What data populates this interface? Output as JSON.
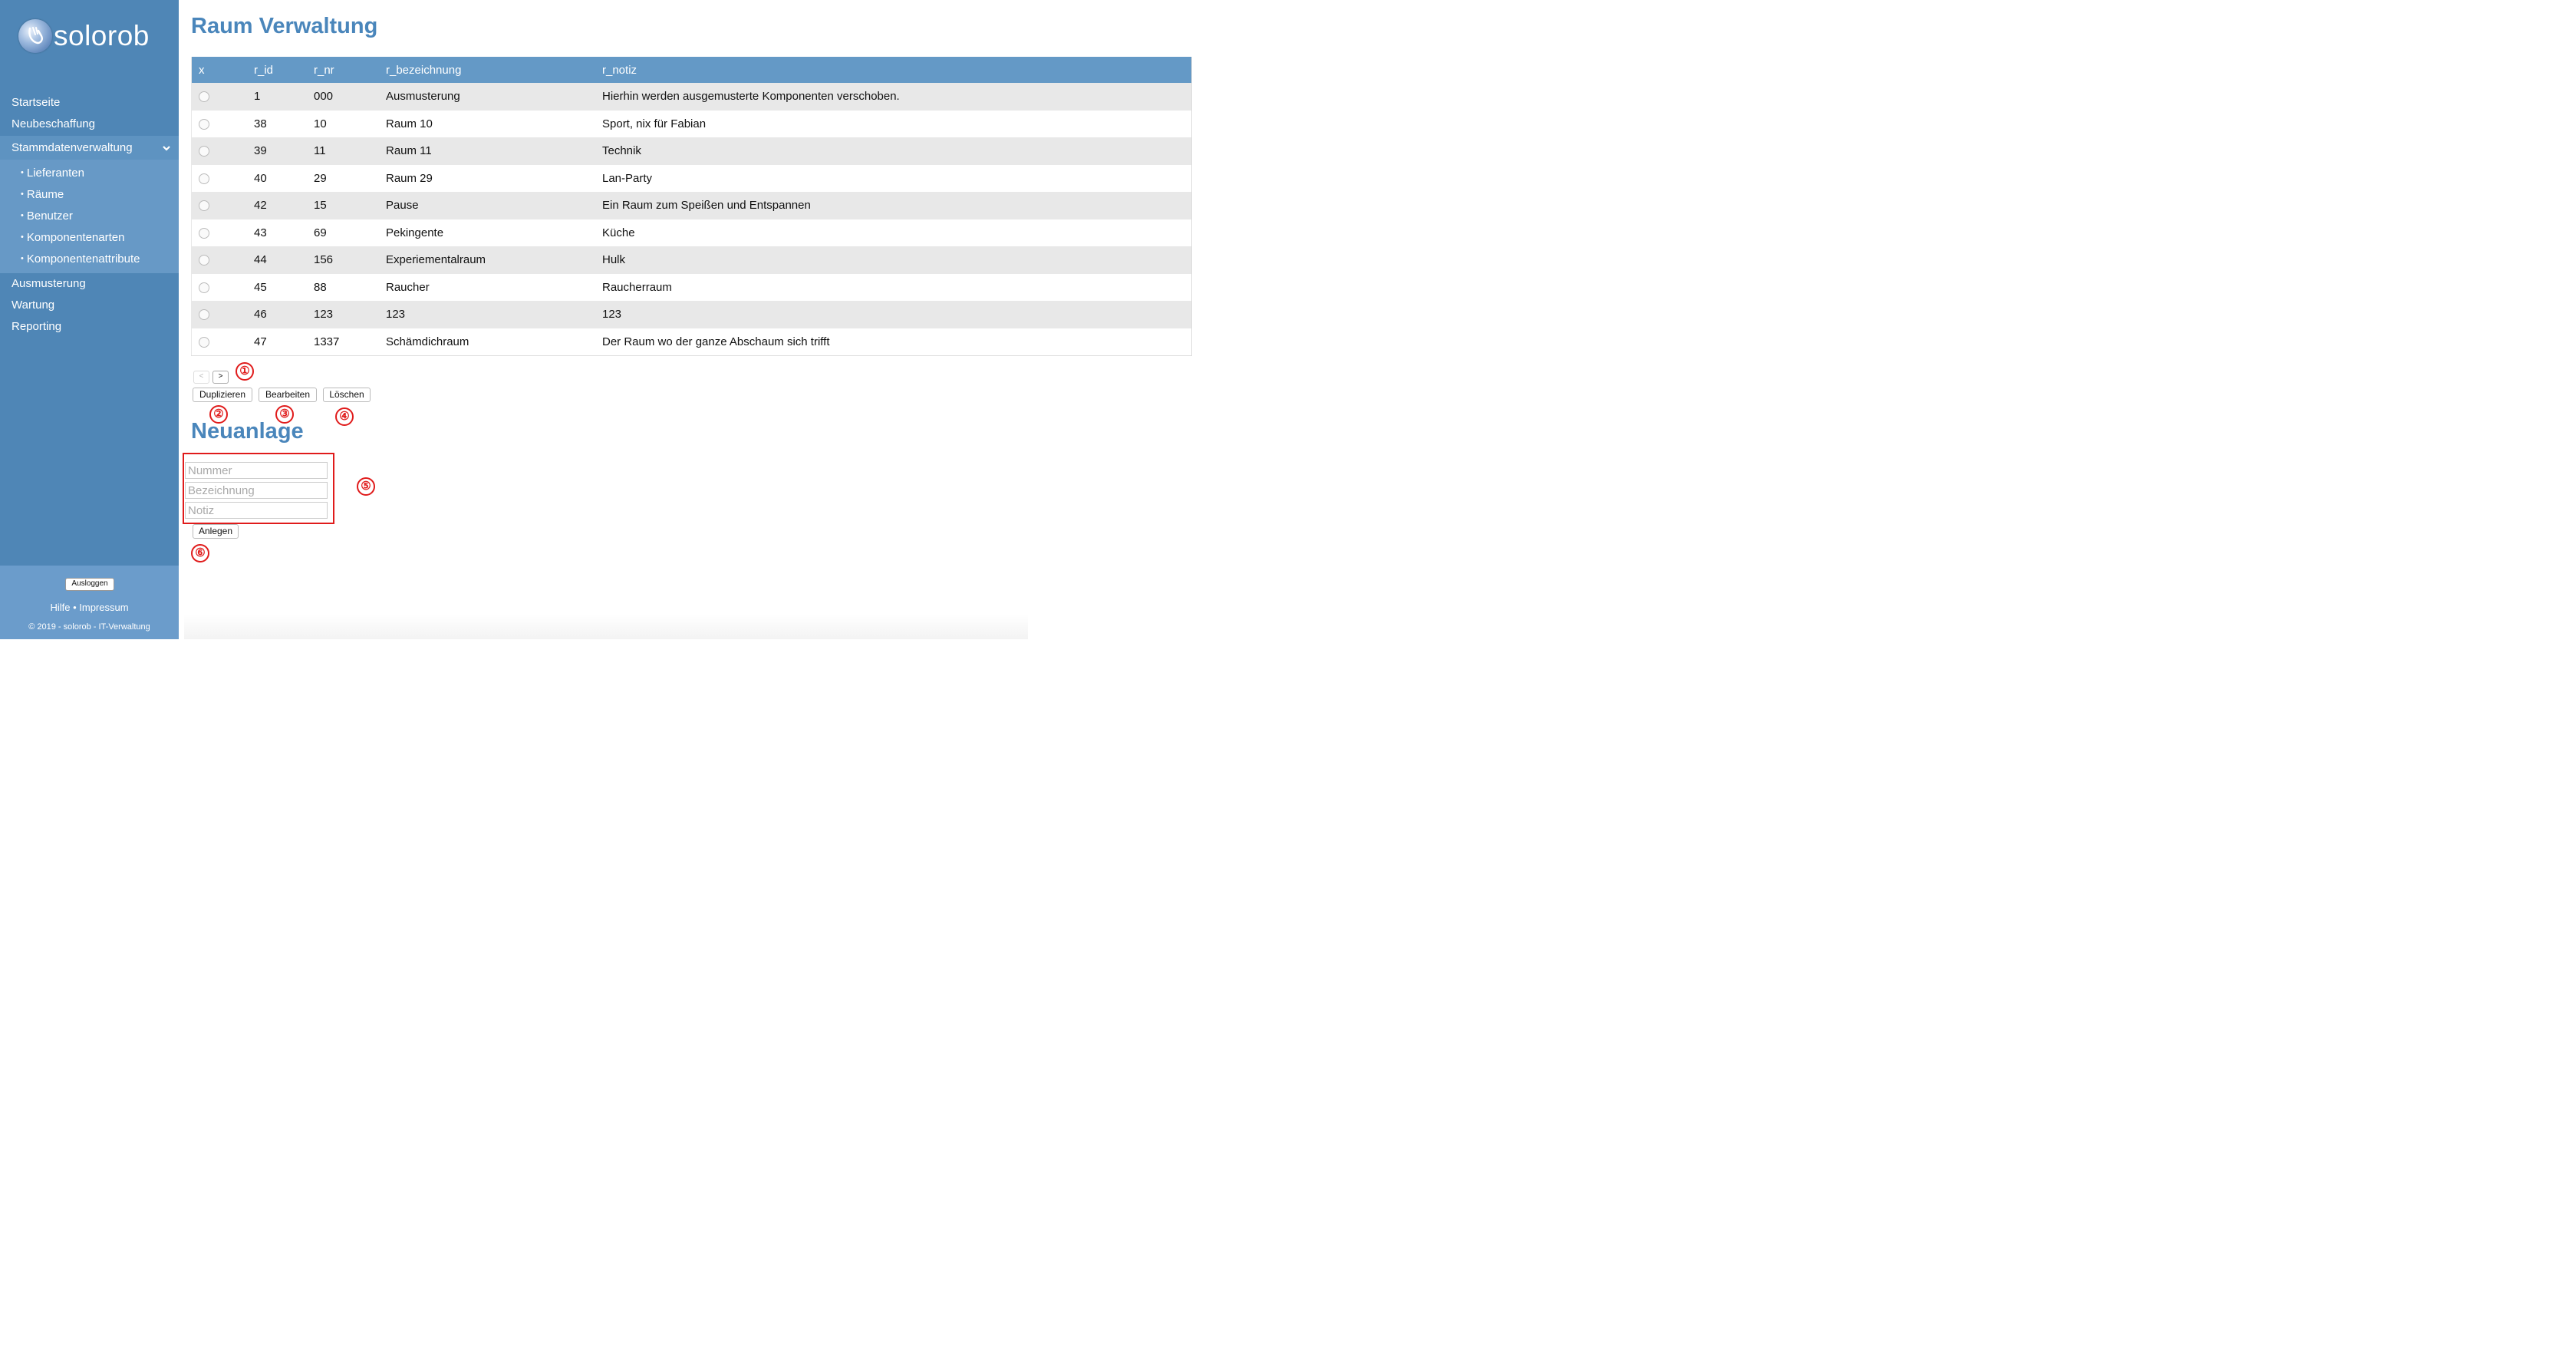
{
  "app": {
    "name": "solorob"
  },
  "nav": {
    "items": [
      {
        "label": "Startseite"
      },
      {
        "label": "Neubeschaffung"
      }
    ],
    "active": {
      "label": "Stammdatenverwaltung",
      "chevron": "v"
    },
    "subitems": [
      {
        "label": "Lieferanten"
      },
      {
        "label": "Räume"
      },
      {
        "label": "Benutzer"
      },
      {
        "label": "Komponentenarten"
      },
      {
        "label": "Komponentenattribute"
      }
    ],
    "items_after": [
      {
        "label": "Ausmusterung"
      },
      {
        "label": "Wartung"
      },
      {
        "label": "Reporting"
      }
    ],
    "bullet": "•"
  },
  "footer": {
    "logout": "Ausloggen",
    "help": "Hilfe",
    "separator": "•",
    "imprint": "Impressum",
    "copyright": "© 2019 - solorob - IT-Verwaltung"
  },
  "page": {
    "title": "Raum Verwaltung",
    "table": {
      "columns": [
        "x",
        "r_id",
        "r_nr",
        "r_bezeichnung",
        "r_notiz"
      ],
      "rows": [
        [
          "1",
          "000",
          "Ausmusterung",
          "Hierhin werden ausgemusterte Komponenten verschoben."
        ],
        [
          "38",
          "10",
          "Raum 10",
          "Sport, nix für Fabian"
        ],
        [
          "39",
          "11",
          "Raum 11",
          "Technik"
        ],
        [
          "40",
          "29",
          "Raum 29",
          "Lan-Party"
        ],
        [
          "42",
          "15",
          "Pause",
          "Ein Raum zum Speißen und Entspannen"
        ],
        [
          "43",
          "69",
          "Pekingente",
          "Küche"
        ],
        [
          "44",
          "156",
          "Experiementalraum",
          "Hulk"
        ],
        [
          "45",
          "88",
          "Raucher",
          "Raucherraum"
        ],
        [
          "46",
          "123",
          "123",
          "123"
        ],
        [
          "47",
          "1337",
          "Schämdichraum",
          "Der Raum wo der ganze Abschaum sich trifft"
        ]
      ]
    },
    "pager": {
      "prev": "<",
      "next": ">"
    },
    "buttons": {
      "duplicate": "Duplizieren",
      "edit": "Bearbeiten",
      "delete": "Löschen"
    },
    "new_section": {
      "title": "Neuanlage",
      "fields": {
        "number": "Nummer",
        "name": "Bezeichnung",
        "note": "Notiz"
      },
      "create": "Anlegen"
    },
    "markers": [
      "①",
      "②",
      "③",
      "④",
      "⑤",
      "⑥"
    ]
  },
  "colors": {
    "sidebar": "#4f86b6",
    "accent": "#4a86bb",
    "table_header": "#6499c6",
    "marker": "#e01b1b"
  },
  "icons": {
    "logo": "hand-sphere-icon",
    "chevron": "chevron-down-icon",
    "radio": "radio-icon"
  }
}
